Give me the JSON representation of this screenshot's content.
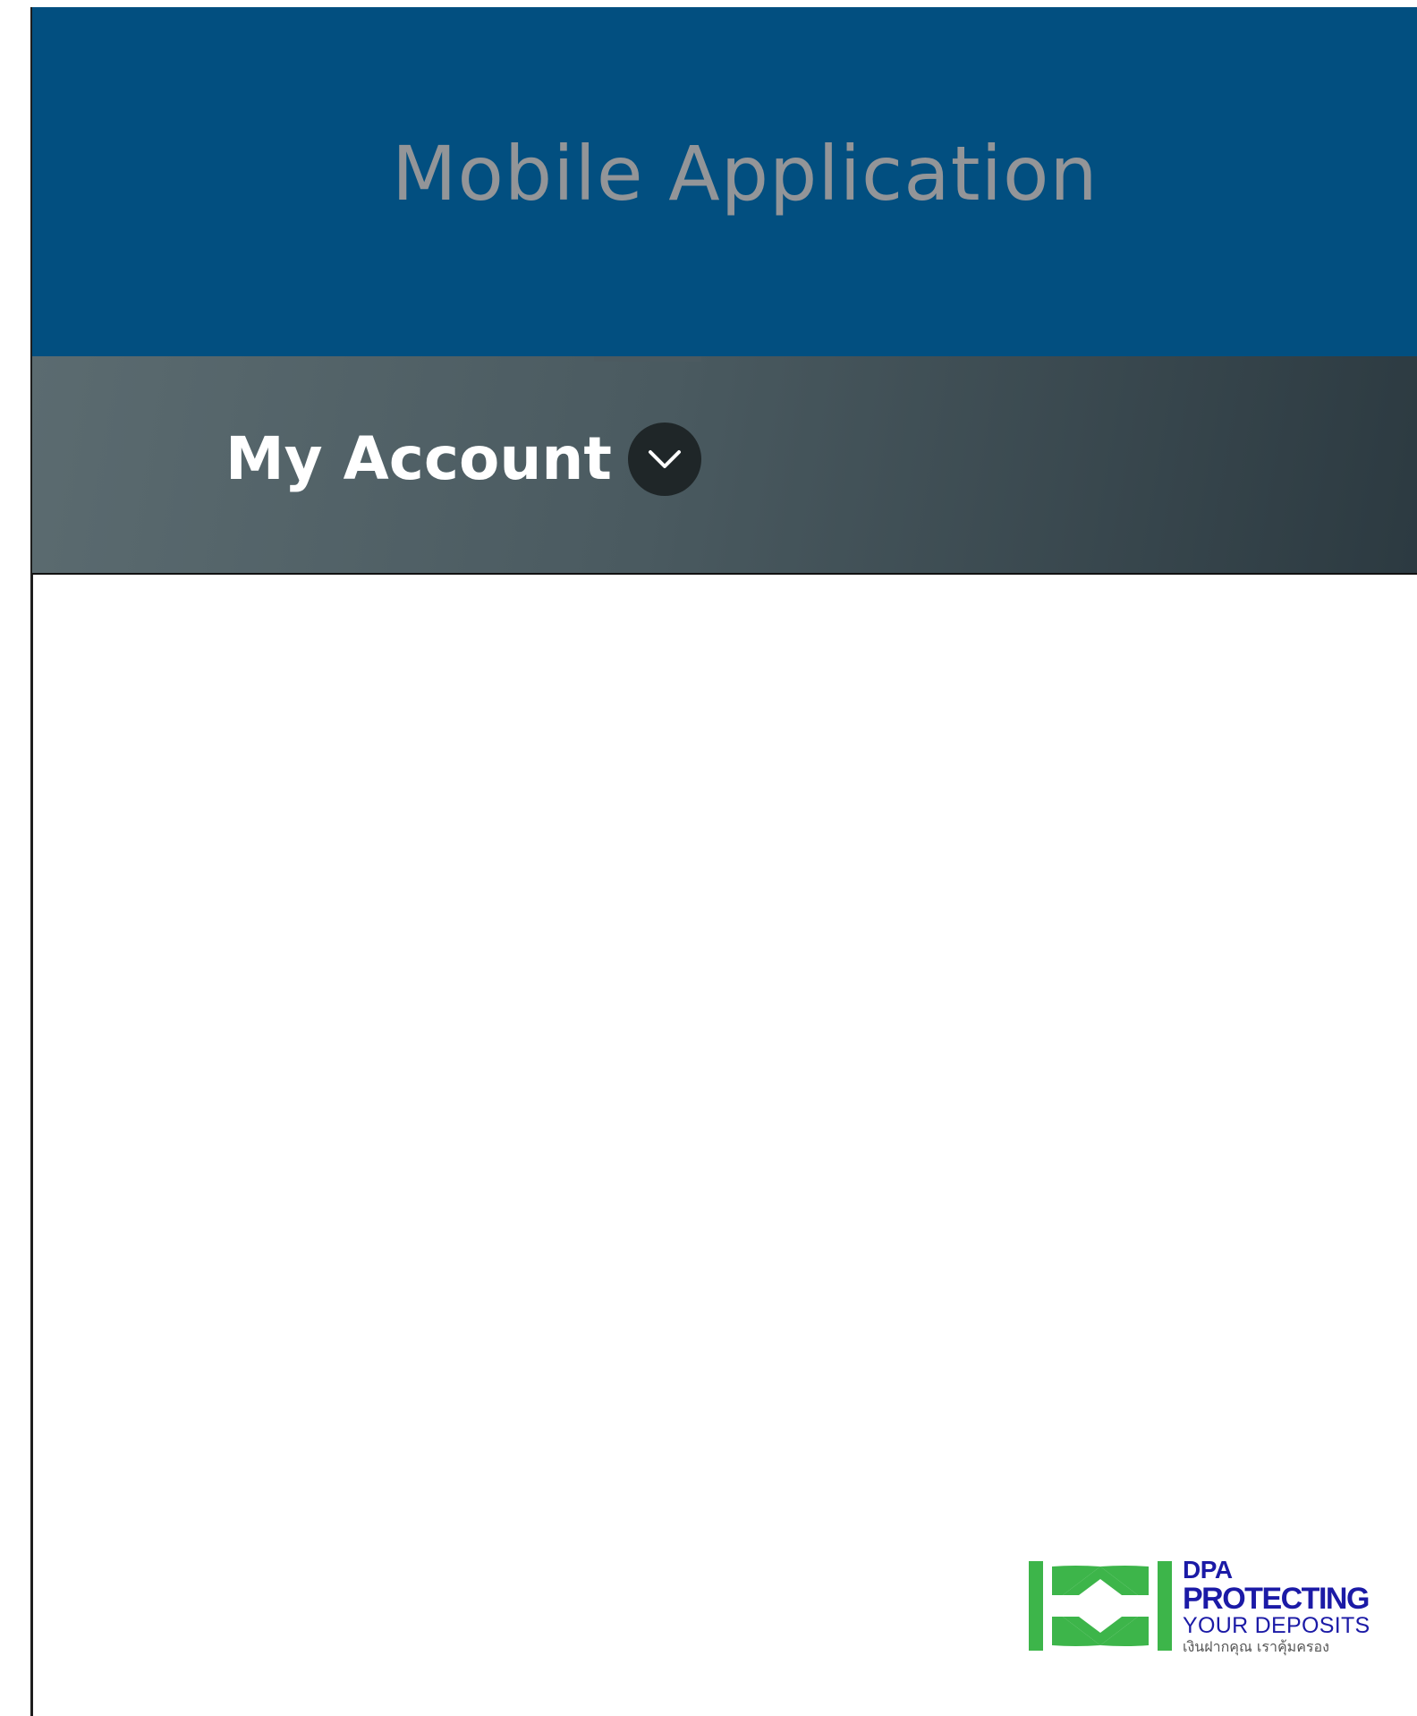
{
  "header": {
    "title": "Mobile Application"
  },
  "account_bar": {
    "label": "My Account",
    "toggle_icon": "chevron-down-icon"
  },
  "footer_logo": {
    "line1": "DPA",
    "line2": "PROTECTING",
    "line3": "YOUR DEPOSITS",
    "line4": "เงินฝากคุณ เราคุ้มครอง",
    "mark_color": "#3db54a",
    "text_color": "#1b1aa6"
  },
  "colors": {
    "header_bg": "#024f80",
    "title_text": "#939598",
    "account_bar_bg_start": "#5b6b70",
    "account_bar_bg_end": "#2c3a41",
    "account_label_text": "#ffffff",
    "chevron_bg": "#1f2628"
  }
}
